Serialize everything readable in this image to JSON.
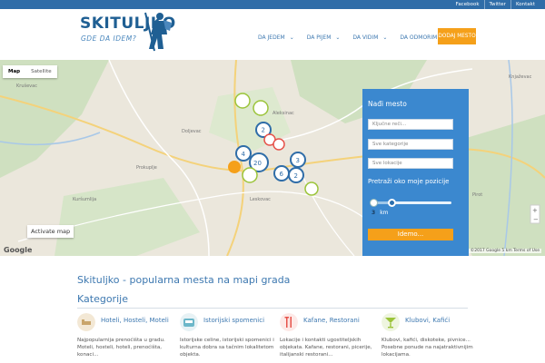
{
  "toplinks": [
    "Facebook",
    "Twitter",
    "Kontakt"
  ],
  "logo": {
    "title": "SKITULJKO",
    "subtitle": "GDE DA IDEM?"
  },
  "nav": [
    {
      "label": "DA JEDEM"
    },
    {
      "label": "DA PIJEM"
    },
    {
      "label": "DA VIDIM"
    },
    {
      "label": "DA ODMORIM"
    }
  ],
  "add_button": "DODAJ MESTO",
  "map": {
    "type_map": "Map",
    "type_satellite": "Satellite",
    "activate": "Activate map",
    "google": "Google",
    "attribution": "Map data ©2017 Google   5 km   Terms of Use",
    "clusters": [
      "2",
      "20",
      "4",
      "3",
      "6",
      "2"
    ]
  },
  "panel": {
    "title": "Nađi mesto",
    "keyword_placeholder": "Ključne reči...",
    "category_placeholder": "Sve kategorije",
    "location_placeholder": "Sve lokacije",
    "geo_title": "Pretraži oko moje pozicije",
    "radius_value": "3",
    "radius_unit": "km",
    "search_button": "Idemo..."
  },
  "tagline": "Skituljko - popularna mesta na mapi grada",
  "categories_title": "Kategorije",
  "categories": [
    {
      "name": "Hoteli, Hosteli, Moteli",
      "desc": "Najpopularnija prenoćišta u gradu. Moteli, hosteli, hoteli, prenoćišta, konaci...",
      "color": "#f3e8d5"
    },
    {
      "name": "Istorijski spomenici",
      "desc": "Istorijske celine, istorijski spomenici i kulturna dobra sa tačnim lokalitetom objekta.",
      "color": "#6cb7c9"
    },
    {
      "name": "Kafane, Restorani",
      "desc": "Lokacije i kontakti ugostiteljskih objekata. Kafane, restorani, picerije, italijanski restorani...",
      "color": "#e6524a"
    },
    {
      "name": "Klubovi, Kafići",
      "desc": "Klubovi, kafići, diskoteke, pivnice... Posebne ponude na najatraktivnijim lokacijama.",
      "color": "#9bc43a"
    }
  ]
}
